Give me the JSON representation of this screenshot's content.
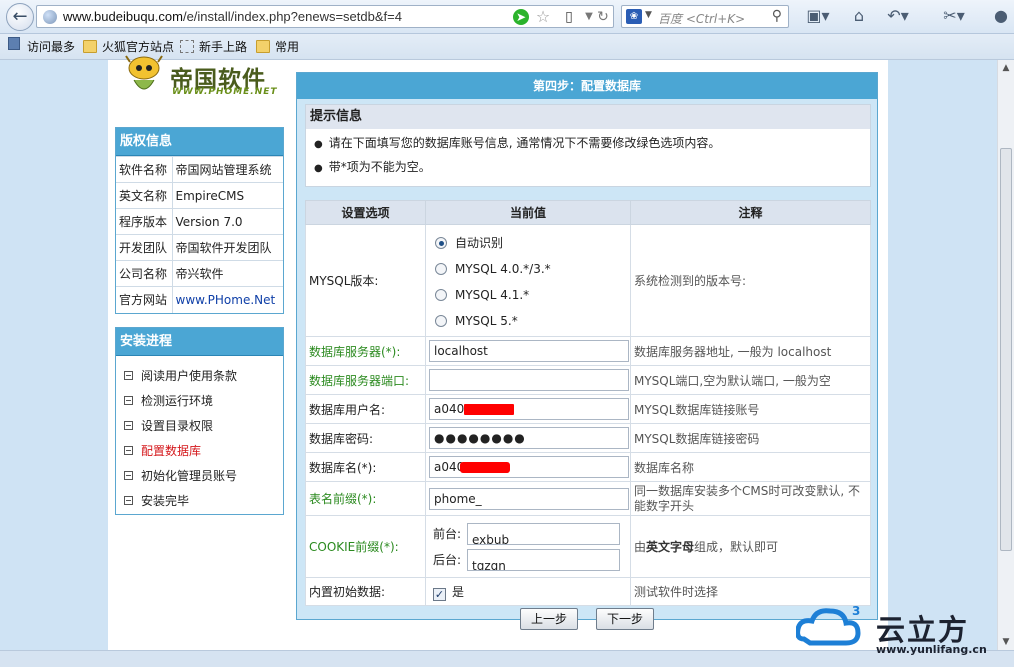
{
  "browser": {
    "url_host": "www.budeibuqu.com",
    "url_path": "/e/install/index.php?enews=setdb&f=4",
    "search_placeholder": "百度 <Ctrl+K>",
    "search_engine_icon": "paw-icon"
  },
  "bookmarks": [
    {
      "label": "访问最多",
      "icon": "folder-icon"
    },
    {
      "label": "火狐官方站点",
      "icon": "firefox-icon"
    },
    {
      "label": "新手上路",
      "icon": "dashed-page-icon"
    },
    {
      "label": "常用",
      "icon": "folder-icon"
    }
  ],
  "logo": {
    "brand": "帝国软件",
    "site": "WWW.PHOME.NET"
  },
  "copyright_box": {
    "title": "版权信息",
    "rows": [
      {
        "k": "软件名称",
        "v": "帝国网站管理系统"
      },
      {
        "k": "英文名称",
        "v": "EmpireCMS"
      },
      {
        "k": "程序版本",
        "v": "Version 7.0"
      },
      {
        "k": "开发团队",
        "v": "帝国软件开发团队"
      },
      {
        "k": "公司名称",
        "v": "帝兴软件"
      },
      {
        "k": "官方网站",
        "v": "www.PHome.Net"
      }
    ]
  },
  "progress_box": {
    "title": "安装进程",
    "steps": [
      "阅读用户使用条款",
      "检测运行环境",
      "设置目录权限",
      "配置数据库",
      "初始化管理员账号",
      "安装完毕"
    ],
    "active_index": 3
  },
  "main": {
    "title": "第四步：配置数据库",
    "tip_title": "提示信息",
    "tips": [
      "请在下面填写您的数据库账号信息, 通常情况下不需要修改绿色选项内容。",
      "带*项为不能为空。"
    ],
    "headers": [
      "设置选项",
      "当前值",
      "注释"
    ],
    "mysql": {
      "label": "MYSQL版本:",
      "options": [
        "自动识别",
        "MYSQL 4.0.*/3.*",
        "MYSQL 4.1.*",
        "MYSQL 5.*"
      ],
      "selected": 0,
      "note": "系统检测到的版本号:"
    },
    "fields": [
      {
        "label": "数据库服务器(*):",
        "value": "localhost",
        "note": "数据库服务器地址, 一般为 localhost",
        "green": true
      },
      {
        "label": "数据库服务器端口:",
        "value": "",
        "note": "MYSQL端口,空为默认端口, 一般为空",
        "green": true
      },
      {
        "label": "数据库用户名:",
        "value": "a040",
        "note": "MYSQL数据库链接账号",
        "green": false
      },
      {
        "label": "数据库密码:",
        "value": "●●●●●●●●",
        "note": "MYSQL数据库链接密码",
        "green": false
      },
      {
        "label": "数据库名(*):",
        "value": "a040",
        "note": "数据库名称",
        "green": false
      },
      {
        "label": "表名前缀(*):",
        "value": "phome_",
        "note_line1": "同一数据库安装多个CMS时可改变默认, 不",
        "note_line2": "能数字开头",
        "green": true
      }
    ],
    "cookie": {
      "label": "COOKIE前缀(*):",
      "front_label": "前台:",
      "front_value": "exbub",
      "back_label": "后台:",
      "back_value": "tgzqn",
      "note_pre": "由",
      "note_bold": "英文字母",
      "note_post": "组成，默认即可"
    },
    "builtin": {
      "label": "内置初始数据:",
      "checked": true,
      "check_label": "是",
      "note": "测试软件时选择"
    },
    "prev_button": "上一步",
    "next_button": "下一步"
  },
  "watermark": {
    "text": "云立方",
    "sub": "www.yunlifang.cn",
    "sup": "3"
  }
}
